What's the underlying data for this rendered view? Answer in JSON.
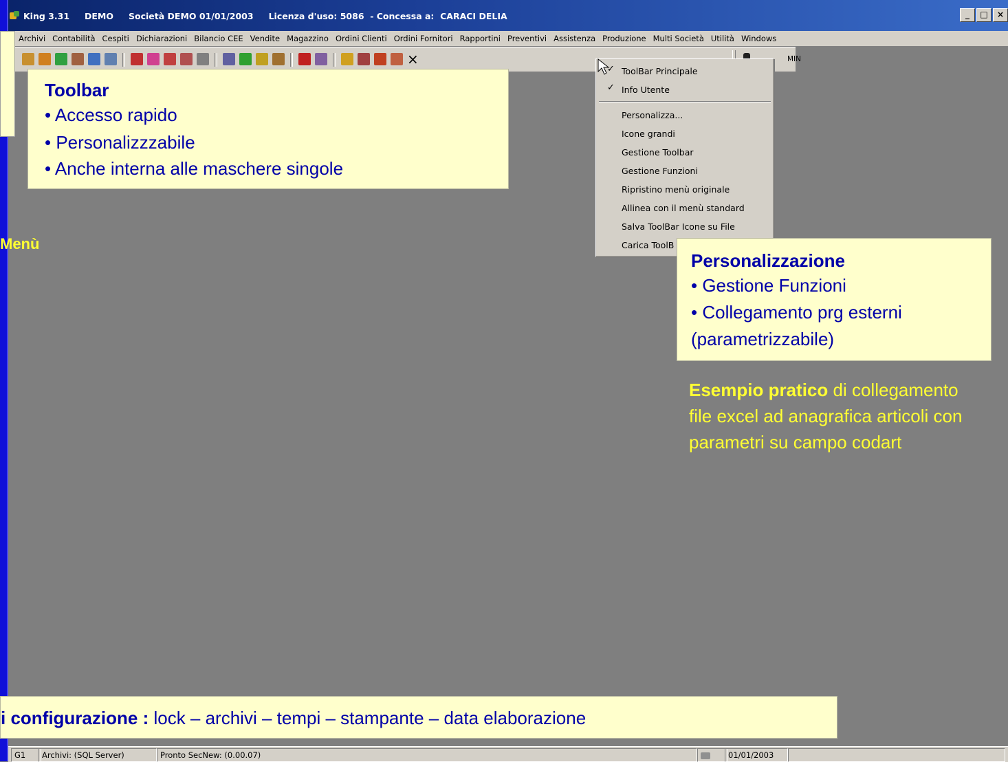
{
  "window": {
    "title_segments": [
      "King 3.31",
      "DEMO",
      "Società DEMO 01/01/2003",
      "Licenza d'uso: 5086  - Concessa a:  CARACI DELIA"
    ],
    "buttons": [
      "_",
      "□",
      "×"
    ]
  },
  "menubar": {
    "items": [
      "Archivi",
      "Contabilità",
      "Cespiti",
      "Dichiarazioni",
      "Bilancio CEE",
      "Vendite",
      "Magazzino",
      "Ordini Clienti",
      "Ordini Fornitori",
      "Rapportini",
      "Preventivi",
      "Assistenza",
      "Produzione",
      "Multi Società",
      "Utilità",
      "Windows"
    ]
  },
  "toolbar": {
    "icons": [
      {
        "name": "book-icon",
        "color": "#c89030"
      },
      {
        "name": "user-icon",
        "color": "#d08020"
      },
      {
        "name": "user-green-icon",
        "color": "#30a040"
      },
      {
        "name": "phone-icon",
        "color": "#a06040"
      },
      {
        "name": "pen-icon",
        "color": "#4070c0"
      },
      {
        "name": "calendar-icon",
        "color": "#6080b0"
      },
      {
        "name": "doc-red-icon",
        "color": "#c03030"
      },
      {
        "name": "doc-pink-icon",
        "color": "#d04090"
      },
      {
        "name": "doc-r-icon",
        "color": "#c04040"
      },
      {
        "name": "doc-f-icon",
        "color": "#b05050"
      },
      {
        "name": "doc-copy-icon",
        "color": "#808080"
      },
      {
        "name": "report-icon",
        "color": "#6060a0"
      },
      {
        "name": "chart-icon",
        "color": "#30a030"
      },
      {
        "name": "truck-icon",
        "color": "#c0a020"
      },
      {
        "name": "clipboard-icon",
        "color": "#a07030"
      },
      {
        "name": "book-red-icon",
        "color": "#c02020"
      },
      {
        "name": "tools-icon",
        "color": "#8060a0"
      },
      {
        "name": "help-icon",
        "color": "#d0a020"
      },
      {
        "name": "people-icon",
        "color": "#a04040"
      },
      {
        "name": "fb-icon",
        "color": "#c04020"
      },
      {
        "name": "globe-icon",
        "color": "#c06040"
      }
    ],
    "close_glyph": "×",
    "user_label": "MIN"
  },
  "toolbar_callout": {
    "title": "Toolbar",
    "bullets": [
      "• Accesso rapido",
      "• Personalizzzabile",
      "• Anche interna alle maschere singole"
    ]
  },
  "menu_label": "Menù",
  "context_menu": {
    "items": [
      "ToolBar Principale",
      "Info Utente",
      "Personalizza...",
      "Icone grandi",
      "Gestione Toolbar",
      "Gestione Funzioni",
      "Ripristino menù originale",
      "Allinea con il menù standard",
      "Salva ToolBar Icone su File",
      "Carica ToolB"
    ],
    "check": "✓"
  },
  "personalizzazione_callout": {
    "title": "Personalizzazione",
    "bullets": [
      "• Gestione Funzioni",
      "• Collegamento prg esterni",
      "(parametrizzabile)"
    ]
  },
  "example": {
    "strong": "Esempio pratico",
    "rest": " di collegamento file excel ad anagrafica articoli con parametri su campo codart"
  },
  "config": {
    "strong": "i configurazione :",
    "rest": " lock – archivi – tempi – stampante – data elaborazione"
  },
  "statusbar": {
    "panes": [
      "G1",
      "Archivi: (SQL Server)",
      "Pronto SecNew: (0.00.07)",
      "01/01/2003"
    ]
  },
  "colors": {
    "slide_blue": "#1010d8",
    "callout_bg": "#ffffcc",
    "callout_text": "#0000a8",
    "highlight_yellow": "#ffff33",
    "desktop_gray": "#7f7f7f"
  }
}
